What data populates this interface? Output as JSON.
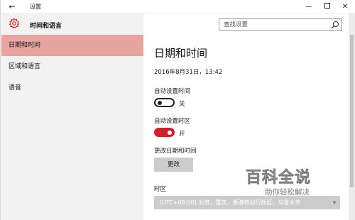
{
  "window": {
    "title": "设置",
    "back_glyph": "←",
    "minimize_glyph": "—",
    "close_glyph": "✕"
  },
  "sidebar": {
    "section_title": "时间和语言",
    "items": [
      {
        "label": "日期和时间",
        "active": true
      },
      {
        "label": "区域和语言",
        "active": false
      },
      {
        "label": "语音",
        "active": false
      }
    ]
  },
  "search": {
    "placeholder": "查找设置"
  },
  "main": {
    "title": "日期和时间",
    "current_datetime": "2016年8月31日，13:42",
    "auto_time": {
      "label": "自动设置时间",
      "state": "关",
      "on": false
    },
    "auto_timezone": {
      "label": "自动设置时区",
      "state": "开",
      "on": true
    },
    "change_datetime": {
      "label": "更改日期和时间",
      "button": "更改"
    },
    "timezone": {
      "label": "时区",
      "value": "(UTC+08:00) 北京，重庆，香港特别行政区，乌鲁木齐"
    }
  },
  "watermark": {
    "logo": "百科全说",
    "subtitle": "助你轻松解决"
  },
  "colors": {
    "accent": "#d3202a",
    "active_item": "#e8a4a0",
    "sidebar_bg": "#f2f2f2"
  }
}
